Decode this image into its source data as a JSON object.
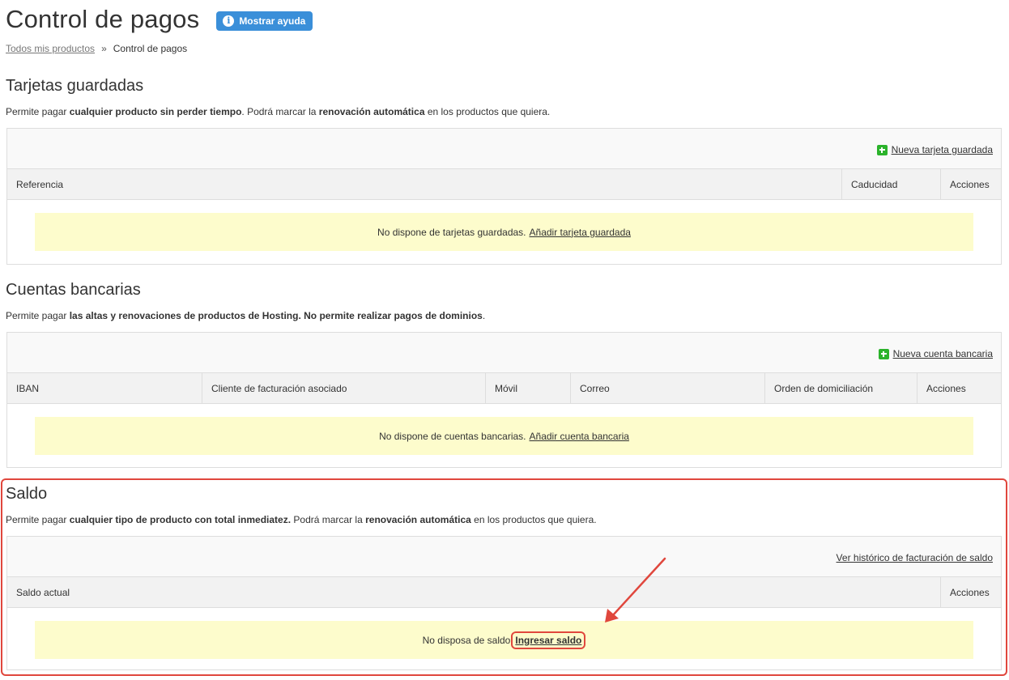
{
  "header": {
    "title": "Control de pagos",
    "help_button": "Mostrar ayuda",
    "help_icon": "i"
  },
  "breadcrumb": {
    "home": "Todos mis productos",
    "separator": "»",
    "current": "Control de pagos"
  },
  "cards": {
    "title": "Tarjetas guardadas",
    "desc_1": "Permite pagar ",
    "desc_2": "cualquier producto sin perder tiempo",
    "desc_3": ". Podrá marcar la ",
    "desc_4": "renovación automática",
    "desc_5": " en los productos que quiera.",
    "action": "Nueva tarjeta guardada",
    "columns": [
      "Referencia",
      "Caducidad",
      "Acciones"
    ],
    "empty_text": "No dispone de tarjetas guardadas.",
    "empty_link": "Añadir tarjeta guardada"
  },
  "accounts": {
    "title": "Cuentas bancarias",
    "desc_1": "Permite pagar ",
    "desc_2": "las altas y renovaciones de productos de Hosting. No permite realizar pagos de dominios",
    "desc_3": ".",
    "action": "Nueva cuenta bancaria",
    "columns": [
      "IBAN",
      "Cliente de facturación asociado",
      "Móvil",
      "Correo",
      "Orden de domiciliación",
      "Acciones"
    ],
    "empty_text": "No dispone de cuentas bancarias.",
    "empty_link": "Añadir cuenta bancaria"
  },
  "balance": {
    "title": "Saldo",
    "desc_1": "Permite pagar ",
    "desc_2": "cualquier tipo de producto con total inmediatez.",
    "desc_3": " Podrá marcar la ",
    "desc_4": "renovación automática",
    "desc_5": " en los productos que quiera.",
    "action": "Ver histórico de facturación de saldo",
    "columns": [
      "Saldo actual",
      "Acciones"
    ],
    "empty_text": "No disposa de saldo",
    "empty_link": "Ingresar saldo"
  },
  "colors": {
    "accent_blue": "#3a8fd9",
    "highlight_red": "#e0473d",
    "empty_bg": "#fdfccc",
    "plus_green": "#2bb32b"
  }
}
